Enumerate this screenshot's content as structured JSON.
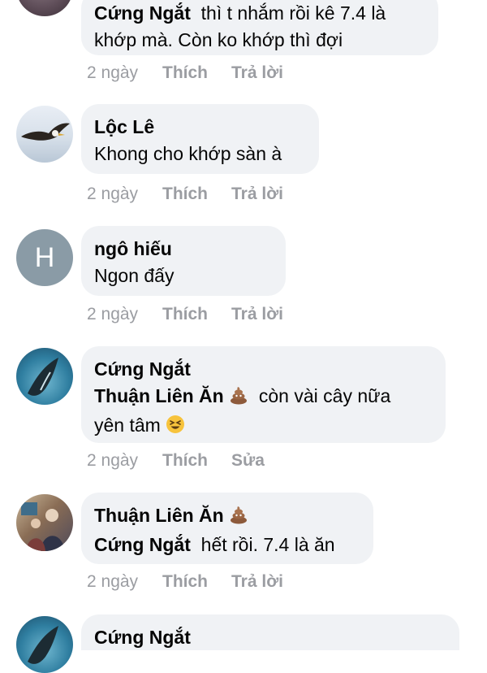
{
  "comments": [
    {
      "author": "Cứng Ngắt",
      "text_line1": "thì t nhắm rồi kê 7.4 là",
      "text_line2": "khớp mà. Còn ko khớp thì đợi",
      "time": "2 ngày",
      "like": "Thích",
      "reply": "Trả lời"
    },
    {
      "author": "Lộc Lê",
      "text": "Khong cho khớp sàn à",
      "time": "2 ngày",
      "like": "Thích",
      "reply": "Trả lời"
    },
    {
      "author": "ngô hiếu",
      "avatar_letter": "H",
      "text": "Ngon đấy",
      "time": "2 ngày",
      "like": "Thích",
      "reply": "Trả lời"
    },
    {
      "author": "Cứng Ngắt",
      "mention": "Thuận Liên Ăn",
      "text_line1": "còn vài cây nữa",
      "text_line2": "yên tâm",
      "time": "2 ngày",
      "like": "Thích",
      "reply": "Sửa"
    },
    {
      "author": "Thuận Liên Ăn",
      "mention": "Cứng Ngắt",
      "text": "hết rồi. 7.4 là ăn",
      "time": "2 ngày",
      "like": "Thích",
      "reply": "Trả lời"
    },
    {
      "author": "Cứng Ngắt"
    }
  ],
  "colors": {
    "bubble": "#f0f2f5",
    "meta": "#9b9da2",
    "avatar_letter_bg": "#8a9ba6"
  },
  "icons": [
    "poop-emoji-icon",
    "laughing-emoji-icon"
  ]
}
